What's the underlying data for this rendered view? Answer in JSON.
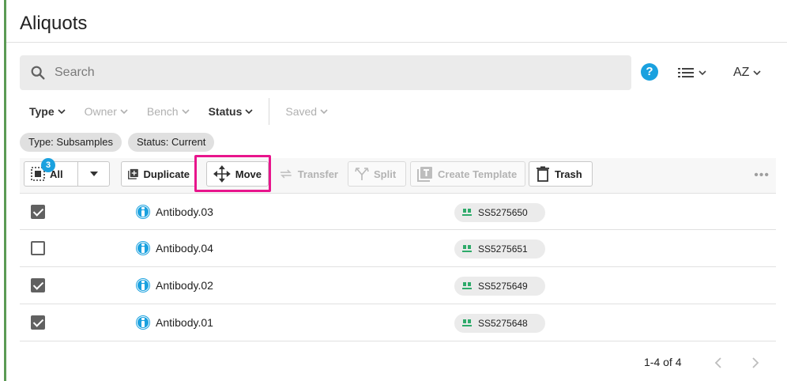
{
  "page": {
    "title": "Aliquots"
  },
  "search": {
    "placeholder": "Search",
    "value": ""
  },
  "header_controls": {
    "help": "?",
    "sort_label": "AZ"
  },
  "filters": [
    {
      "label": "Type",
      "state": "active"
    },
    {
      "label": "Owner",
      "state": "disabled"
    },
    {
      "label": "Bench",
      "state": "disabled"
    },
    {
      "label": "Status",
      "state": "active"
    },
    {
      "label": "Saved",
      "state": "disabled"
    }
  ],
  "chips": [
    {
      "label": "Type: Subsamples"
    },
    {
      "label": "Status: Current"
    }
  ],
  "toolbar": {
    "select_all_label": "All",
    "selected_count": "3",
    "duplicate_label": "Duplicate",
    "move_label": "Move",
    "transfer_label": "Transfer",
    "split_label": "Split",
    "create_template_label": "Create Template",
    "trash_label": "Trash",
    "more_label": "•••"
  },
  "rows": [
    {
      "name": "Antibody.03",
      "id": "SS5275650",
      "checked": true
    },
    {
      "name": "Antibody.04",
      "id": "SS5275651",
      "checked": false
    },
    {
      "name": "Antibody.02",
      "id": "SS5275649",
      "checked": true
    },
    {
      "name": "Antibody.01",
      "id": "SS5275648",
      "checked": true
    }
  ],
  "pagination": {
    "label": "1-4 of 4"
  },
  "colors": {
    "accent": "#1aa1df",
    "highlight": "#e8158c",
    "left_border": "#5b9a54"
  }
}
